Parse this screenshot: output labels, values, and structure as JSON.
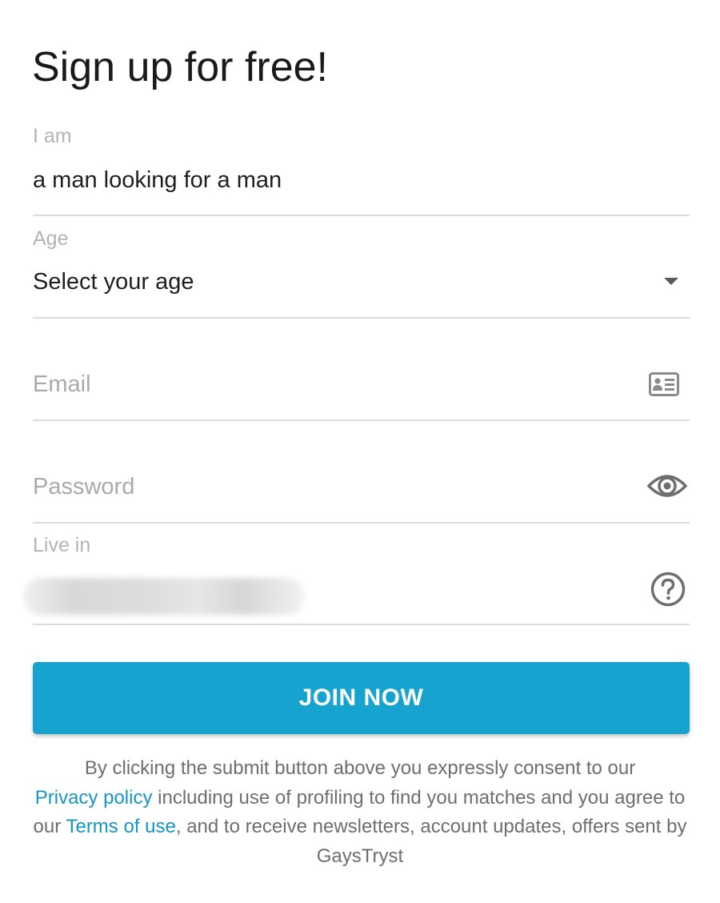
{
  "form": {
    "title": "Sign up for free!",
    "i_am": {
      "label": "I am",
      "value": "a man looking for a man"
    },
    "age": {
      "label": "Age",
      "value": "Select your age",
      "icon": "caret-down-icon"
    },
    "email": {
      "placeholder": "Email",
      "icon": "contact-card-icon"
    },
    "password": {
      "placeholder": "Password",
      "icon": "eye-icon"
    },
    "live_in": {
      "label": "Live in",
      "icon": "help-circle-icon"
    },
    "submit_label": "JOIN NOW"
  },
  "consent": {
    "part1": "By clicking the submit button above you expressly consent to our",
    "privacy_link": "Privacy policy",
    "part2": "including use of profiling to find you matches and you agree to our",
    "terms_link": "Terms of use",
    "part3": ", and to receive newsletters, account updates, offers sent by GaysTryst"
  },
  "colors": {
    "accent": "#17a3cf",
    "link": "#1596c4",
    "divider": "#dcdcdc",
    "label": "#b3b3b3"
  }
}
